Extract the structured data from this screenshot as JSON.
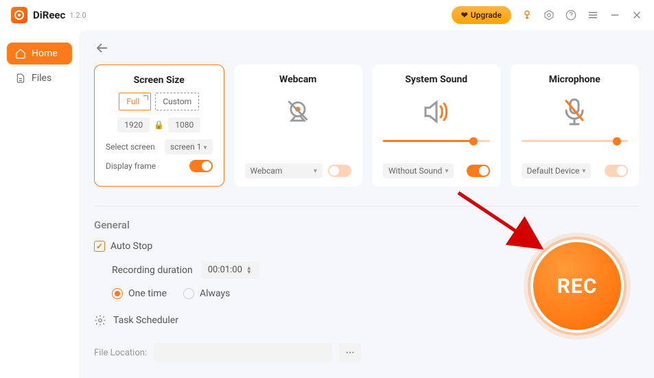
{
  "app": {
    "name": "DiReec",
    "version": "1.2.0"
  },
  "titlebar": {
    "upgrade_label": "Upgrade"
  },
  "nav": {
    "home": "Home",
    "files": "Files"
  },
  "cards": {
    "screen": {
      "title": "Screen Size",
      "full_label": "Full",
      "custom_label": "Custom",
      "width": "1920",
      "height": "1080",
      "select_screen_label": "Select screen",
      "screen_value": "screen 1",
      "display_frame_label": "Display frame"
    },
    "webcam": {
      "title": "Webcam",
      "bottom_label": "Webcam"
    },
    "system_sound": {
      "title": "System Sound",
      "bottom_label": "Without Sound",
      "slider_pct": 85
    },
    "mic": {
      "title": "Microphone",
      "bottom_label": "Default Device",
      "slider_pct": 90
    }
  },
  "general": {
    "title": "General",
    "auto_stop_label": "Auto Stop",
    "duration_label": "Recording duration",
    "duration_value": "00:01:00",
    "one_time_label": "One time",
    "always_label": "Always",
    "task_scheduler_label": "Task Scheduler",
    "file_location_label": "File Location:"
  },
  "rec": {
    "label": "REC"
  }
}
